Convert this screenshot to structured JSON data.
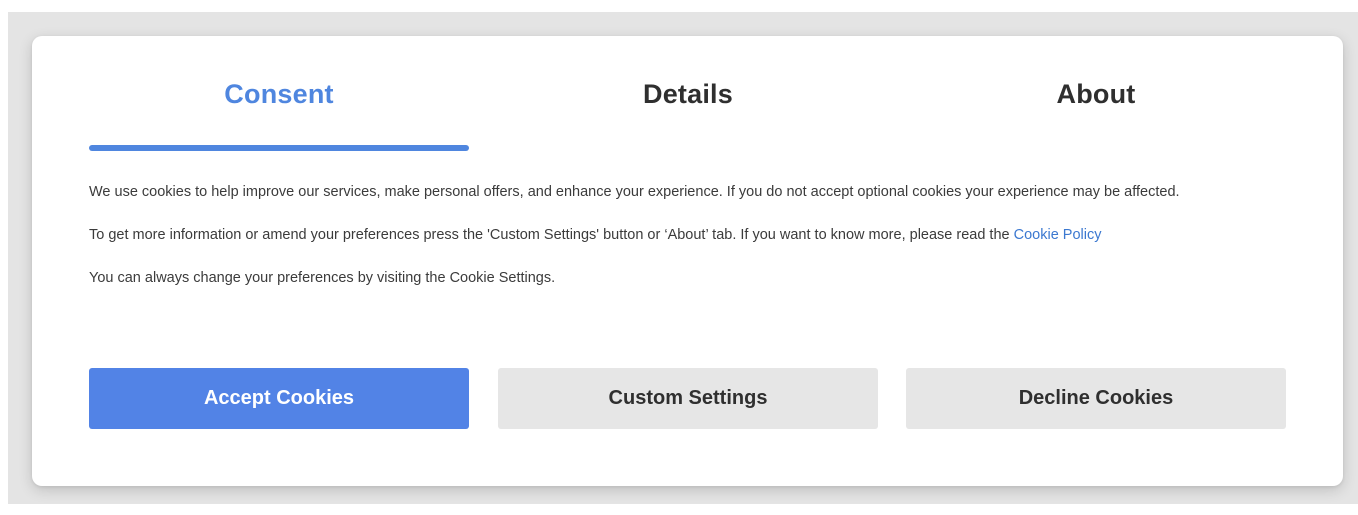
{
  "tabs": [
    {
      "label": "Consent",
      "active": true
    },
    {
      "label": "Details",
      "active": false
    },
    {
      "label": "About",
      "active": false
    }
  ],
  "content": {
    "paragraph_1": "We use cookies to help improve our services, make personal offers, and enhance your experience. If you do not accept optional cookies your experience may be affected.",
    "paragraph_2_text": "To get more information or amend your preferences press the 'Custom Settings' button or ‘About’ tab. If you want to know more, please read the ",
    "paragraph_2_link": "Cookie Policy",
    "paragraph_3": "You can always change your preferences by visiting the Cookie Settings."
  },
  "buttons": {
    "accept_label": "Accept Cookies",
    "custom_label": "Custom Settings",
    "decline_label": "Decline Cookies"
  },
  "colors": {
    "accent": "#5283e6",
    "active_tab": "#4f86df",
    "secondary_button": "#e6e6e6",
    "link": "#3b78d0",
    "backdrop": "#e4e4e4"
  }
}
